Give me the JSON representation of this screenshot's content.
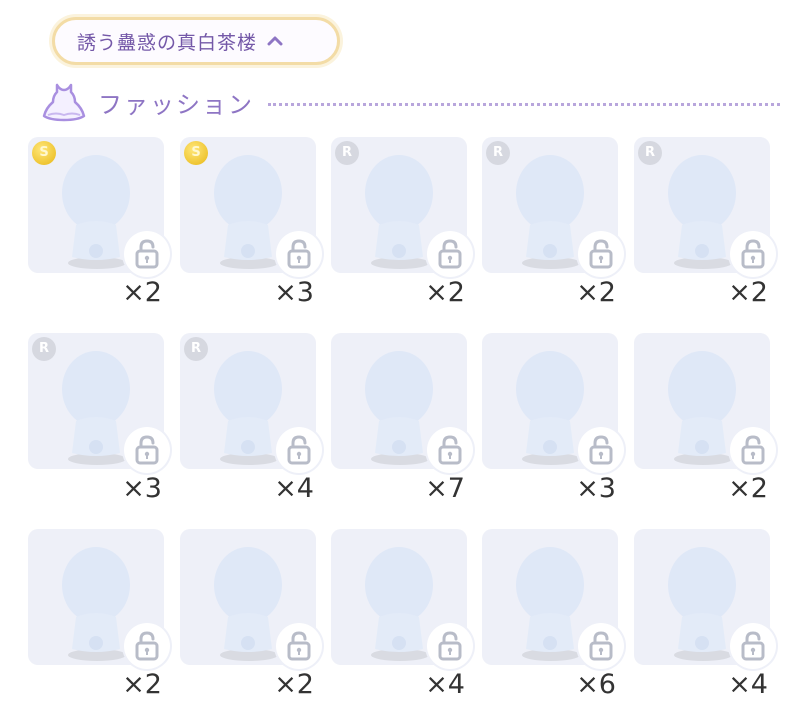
{
  "header": {
    "title": "誘う蠱惑の真白茶楼"
  },
  "section": {
    "title": "ファッション"
  },
  "items": [
    {
      "rank": "S",
      "count": "×2"
    },
    {
      "rank": "S",
      "count": "×3"
    },
    {
      "rank": "R",
      "count": "×2"
    },
    {
      "rank": "R",
      "count": "×2"
    },
    {
      "rank": "R",
      "count": "×2"
    },
    {
      "rank": "R",
      "count": "×3"
    },
    {
      "rank": "R",
      "count": "×4"
    },
    {
      "rank": "",
      "count": "×7"
    },
    {
      "rank": "",
      "count": "×3"
    },
    {
      "rank": "",
      "count": "×2"
    },
    {
      "rank": "",
      "count": "×2"
    },
    {
      "rank": "",
      "count": "×2"
    },
    {
      "rank": "",
      "count": "×4"
    },
    {
      "rank": "",
      "count": "×6"
    },
    {
      "rank": "",
      "count": "×4"
    }
  ],
  "icons": {
    "header_chevron": "chevron-up-icon",
    "section": "dress-icon",
    "lock": "unlock-icon",
    "avatar": "avatar-silhouette-icon"
  },
  "colors": {
    "accent": "#8e75c4",
    "pill_border": "#f3dca6",
    "card_bg": "#eef0f8",
    "rank_s": "#e8b715",
    "rank_r": "#d6d8e0"
  }
}
